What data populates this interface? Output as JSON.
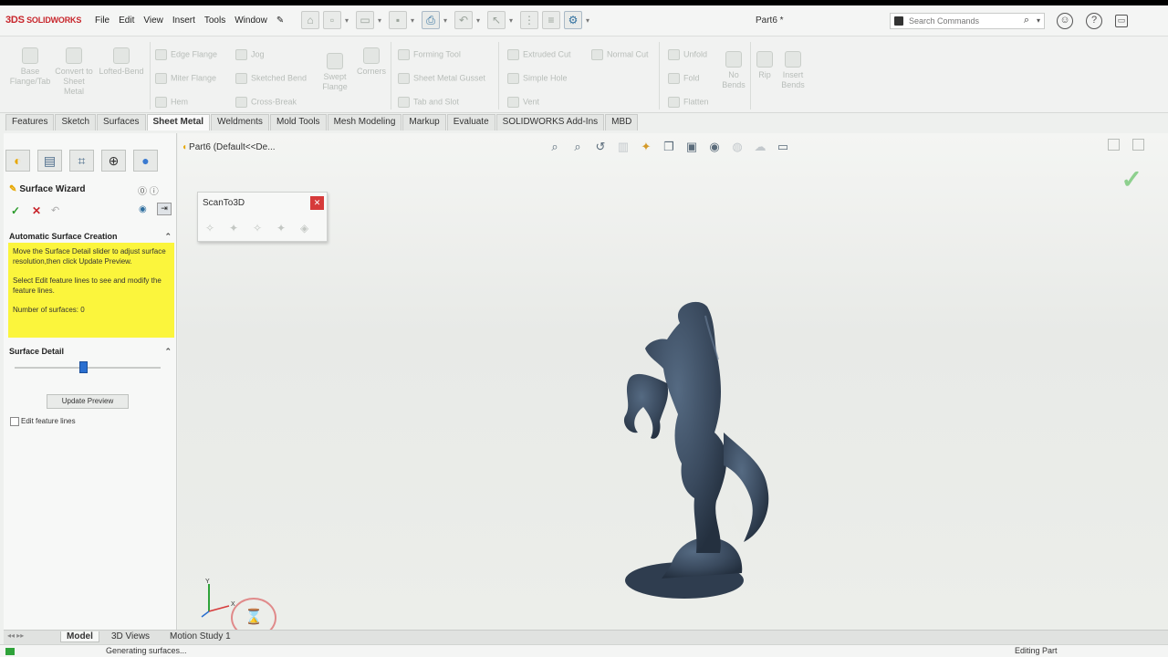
{
  "app": {
    "logo_prefix": "3DS",
    "logo_text": "SOLIDWORKS",
    "document_title": "Part6 *"
  },
  "menu": [
    "File",
    "Edit",
    "View",
    "Insert",
    "Tools",
    "Window"
  ],
  "search": {
    "placeholder": "Search Commands"
  },
  "sheet_metal_tools": {
    "big": [
      {
        "label": "Base Flange/Tab"
      },
      {
        "label": "Convert to Sheet Metal"
      },
      {
        "label": "Lofted-Bend"
      }
    ],
    "col1": [
      "Edge Flange",
      "Miter Flange",
      "Hem"
    ],
    "col2": [
      "Jog",
      "Sketched Bend",
      "Cross-Break"
    ],
    "swept": "Swept Flange",
    "corners": "Corners",
    "col3": [
      "Forming Tool",
      "Sheet Metal Gusset",
      "Tab and Slot"
    ],
    "col4": [
      "Extruded Cut",
      "Simple Hole",
      "Vent"
    ],
    "normal_cut": "Normal Cut",
    "col5": [
      "Unfold",
      "Fold",
      "Flatten"
    ],
    "no_bends": "No Bends",
    "rip": "Rip",
    "insert_bends": "Insert Bends"
  },
  "tabs": [
    "Features",
    "Sketch",
    "Surfaces",
    "Sheet Metal",
    "Weldments",
    "Mold Tools",
    "Mesh Modeling",
    "Markup",
    "Evaluate",
    "SOLIDWORKS Add-Ins",
    "MBD"
  ],
  "active_tab": "Sheet Metal",
  "property_manager": {
    "title": "Surface Wizard",
    "auto_header": "Automatic Surface Creation",
    "message_1": "Move the Surface Detail slider to adjust surface resolution,then click Update Preview.",
    "message_2": "Select Edit feature lines to see and modify the feature lines.",
    "surface_count": "Number of surfaces: 0",
    "detail_header": "Surface Detail",
    "slider_value": 0.47,
    "update_button": "Update Preview",
    "edit_lines": "Edit feature lines"
  },
  "viewport": {
    "breadcrumb": "Part6  (Default<<De...",
    "scanto3d_title": "ScanTo3D"
  },
  "bottom_tabs": [
    "Model",
    "3D Views",
    "Motion Study 1"
  ],
  "status": {
    "message": "Generating surfaces...",
    "mode": "Editing Part"
  },
  "colors": {
    "accent_red": "#c8262c",
    "panel_yellow": "#fbf53c",
    "model": "#3a4a5e"
  }
}
